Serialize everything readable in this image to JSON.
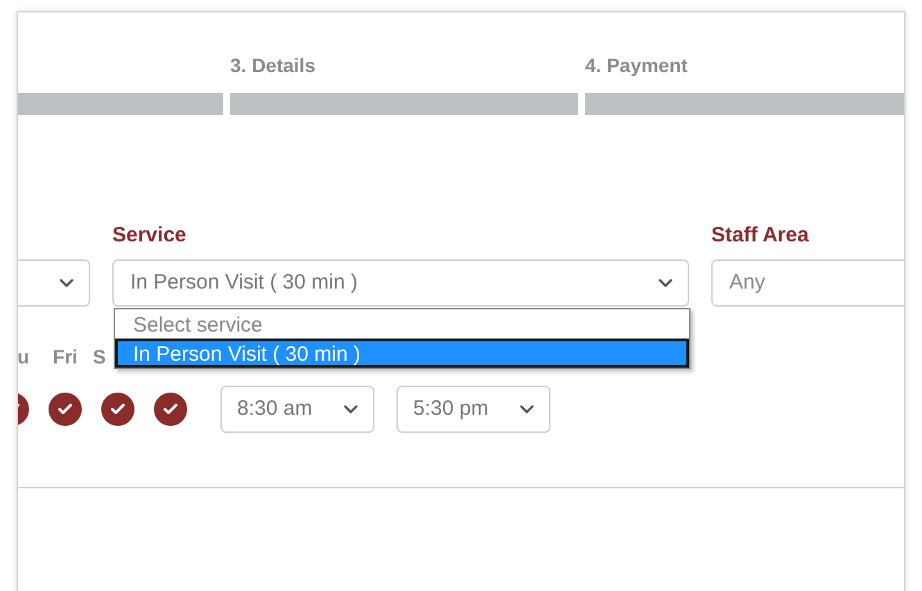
{
  "steps": [
    {
      "label": "3. Details"
    },
    {
      "label": "4. Payment"
    }
  ],
  "fields": [
    {
      "label": "Service",
      "value": "In Person Visit ( 30 min )",
      "expanded": true,
      "options": [
        {
          "label": "Select service",
          "selected": false
        },
        {
          "label": "In Person Visit ( 30 min )",
          "selected": true
        }
      ]
    },
    {
      "label": "Staff Area",
      "value": "Any"
    }
  ],
  "days": [
    {
      "label": "u",
      "checked": true
    },
    {
      "label": "Fri",
      "checked": true
    },
    {
      "label": "S",
      "checked": true
    },
    {
      "checked": true
    }
  ],
  "hours": {
    "start": "8:30 am",
    "end": "5:30 pm"
  }
}
